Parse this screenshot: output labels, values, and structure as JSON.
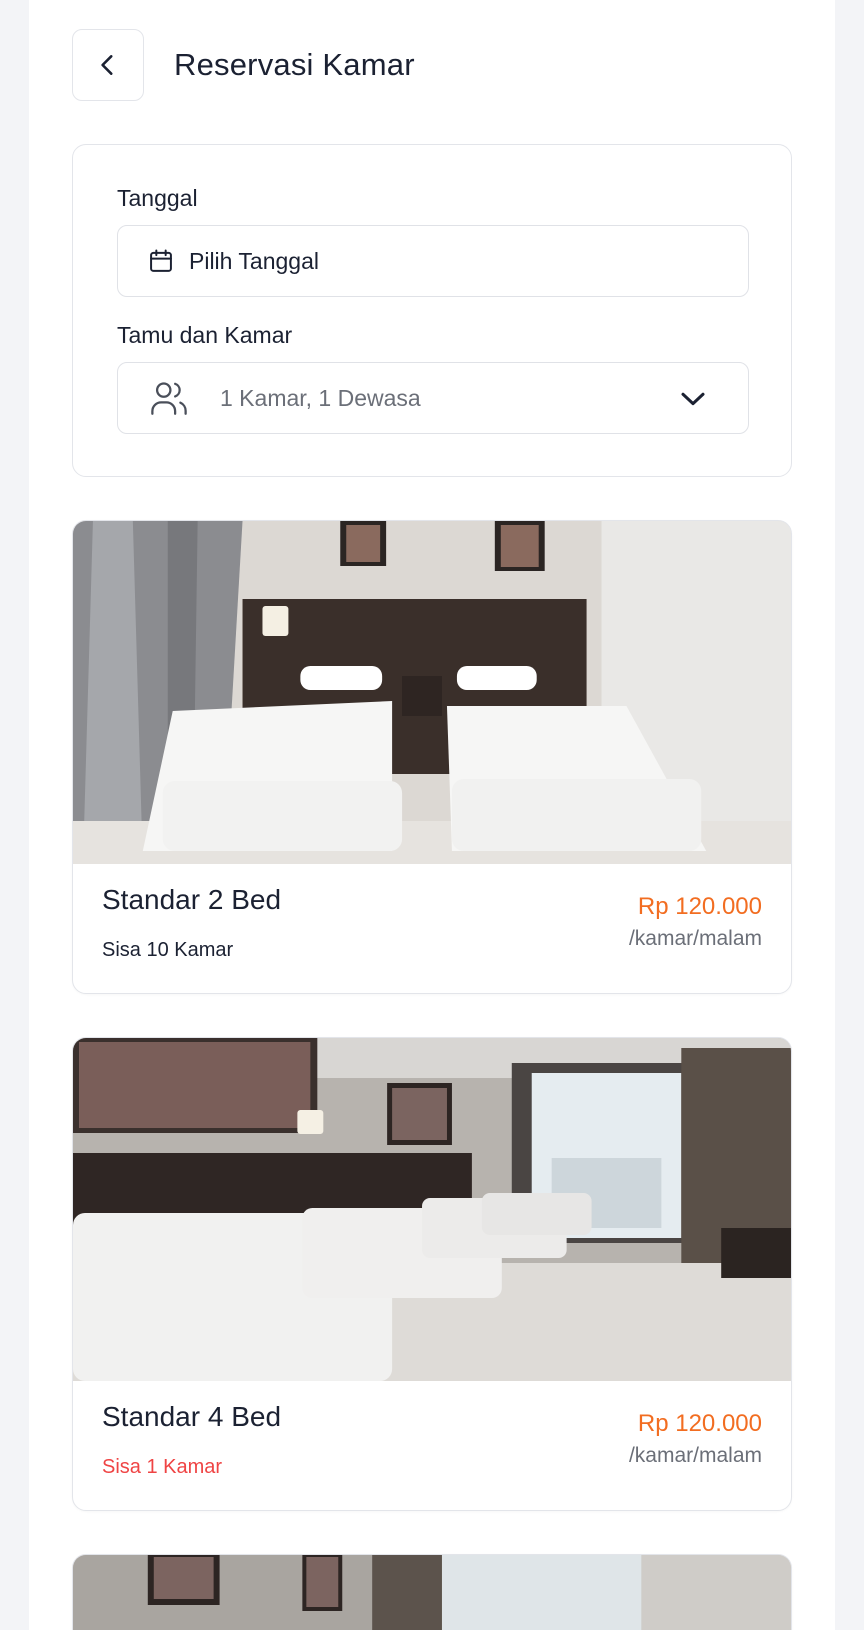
{
  "header": {
    "title": "Reservasi Kamar",
    "back_icon": "chevron-left-icon"
  },
  "form": {
    "date_label": "Tanggal",
    "date_placeholder": "Pilih Tanggal",
    "date_icon": "calendar-icon",
    "guest_label": "Tamu dan Kamar",
    "guest_value": "1 Kamar, 1 Dewasa",
    "guest_icon": "users-icon",
    "dropdown_icon": "chevron-down-icon"
  },
  "rooms": [
    {
      "name": "Standar 2 Bed",
      "availability": "Sisa 10 Kamar",
      "price": "Rp 120.000",
      "unit": "/kamar/malam",
      "image": "room-photo-two-beds"
    },
    {
      "name": "Standar 4 Bed",
      "availability": "Sisa 1 Kamar",
      "price": "Rp 120.000",
      "unit": "/kamar/malam",
      "image": "room-photo-four-beds"
    }
  ],
  "colors": {
    "price": "#f26d21",
    "low_stock": "#ef4444",
    "text": "#1b2132",
    "muted": "#6b6f78",
    "border": "#e3e5ea"
  }
}
